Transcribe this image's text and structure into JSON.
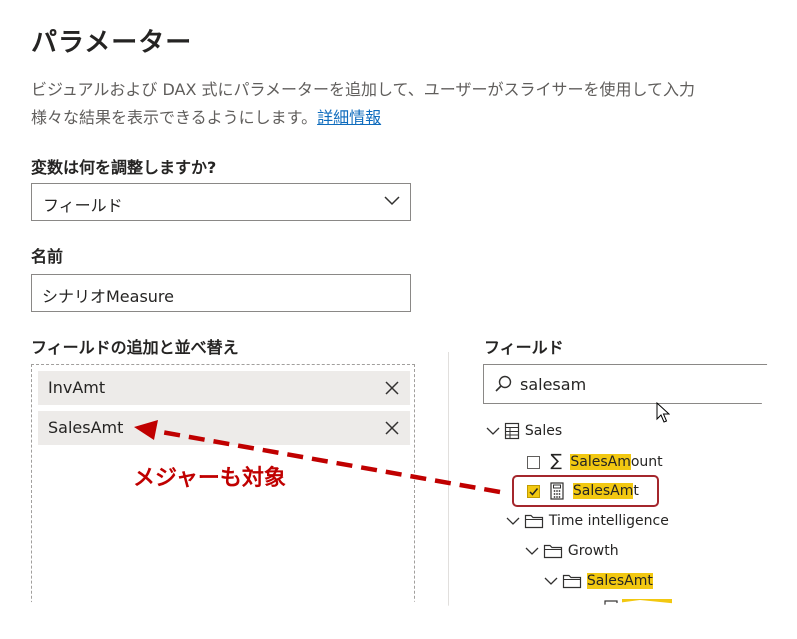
{
  "dialog": {
    "title": "パラメーター",
    "description_line1": "ビジュアルおよび DAX 式にパラメーターを追加して、ユーザーがスライサーを使用して入力",
    "description_line2": "様々な結果を表示できるようにします。",
    "learn_more": "詳細情報"
  },
  "variable": {
    "label": "変数は何を調整しますか?",
    "value": "フィールド"
  },
  "name": {
    "label": "名前",
    "value": "シナリオMeasure"
  },
  "fields_add": {
    "label": "フィールドの追加と並べ替え",
    "items": [
      "InvAmt",
      "SalesAmt"
    ]
  },
  "fields_pane": {
    "label": "フィールド",
    "search_value": "salesam",
    "tree": {
      "sales_table": "Sales",
      "sales_amount_hl": "SalesAm",
      "sales_amount_rest": "ount",
      "sales_amt_hl": "SalesAm",
      "sales_amt_rest": "t",
      "time_intelligence": "Time intelligence",
      "growth": "Growth",
      "growth_sales_amt": "SalesAmt"
    }
  },
  "annotation": {
    "text": "メジャーも対象"
  },
  "colors": {
    "accent_red": "#c00000",
    "highlight": "#f2c811",
    "link": "#0f6cbd"
  }
}
